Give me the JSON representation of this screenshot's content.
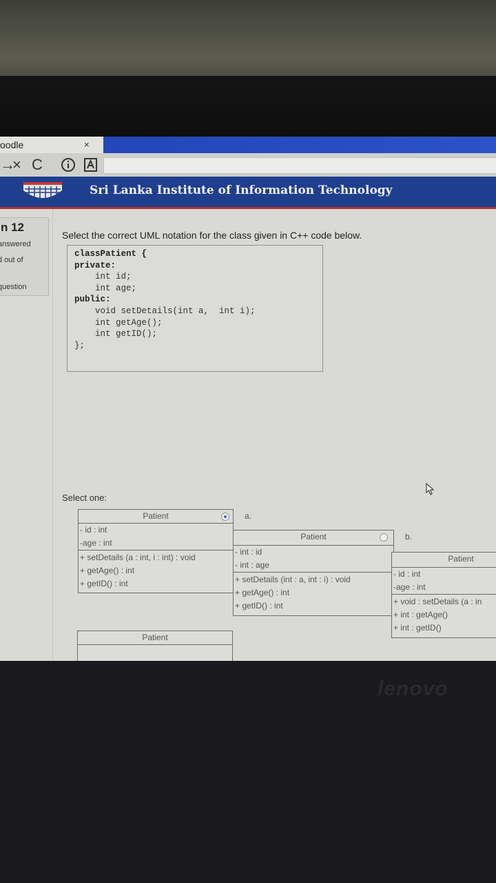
{
  "browser": {
    "tab_title": "oodle",
    "tab_close": "×",
    "nav_back": "→",
    "nav_close": "×",
    "nav_reload": "C"
  },
  "header": {
    "site_title": "Sri Lanka Institute of Information Technology"
  },
  "question_info": {
    "number": "n 12",
    "status": "answered",
    "marks": "d out of",
    "flag": "question"
  },
  "question": {
    "prompt": "Select the correct UML notation for the class given in C++ code below.",
    "code_lines": [
      {
        "indent": 0,
        "text": "classPatient {",
        "bold": true
      },
      {
        "indent": 0,
        "text": "private:",
        "bold": true
      },
      {
        "indent": 2,
        "text": "int id;",
        "bold": false
      },
      {
        "indent": 2,
        "text": "int age;",
        "bold": false
      },
      {
        "indent": 0,
        "text": "public:",
        "bold": true
      },
      {
        "indent": 2,
        "text": "void setDetails(int a,  int i);",
        "bold": false
      },
      {
        "indent": 2,
        "text": "int getAge();",
        "bold": false
      },
      {
        "indent": 2,
        "text": "int getID();",
        "bold": false
      },
      {
        "indent": 0,
        "text": "};",
        "bold": false
      }
    ],
    "select_one": "Select one:"
  },
  "options": [
    {
      "label": "a.",
      "selected": true,
      "class_name": "Patient",
      "attributes": [
        "- id : int",
        "-age : int"
      ],
      "methods": [
        "+ setDetails (a : int,  i : int) : void",
        "+ getAge() : int",
        "+ getID() : int"
      ]
    },
    {
      "label": "b.",
      "selected": false,
      "class_name": "Patient",
      "attributes": [
        "- int : id",
        "- int : age"
      ],
      "methods": [
        "+ setDetails (int : a,  int : i) : void",
        "+ getAge() : int",
        "+ getID() : int"
      ]
    },
    {
      "label": "",
      "selected": false,
      "class_name": "Patient",
      "attributes": [
        "- id : int",
        "-age : int"
      ],
      "methods": [
        "+ void : setDetails (a : in",
        "+ int : getAge()",
        "+ int : getID()"
      ]
    },
    {
      "label": "",
      "selected": false,
      "class_name": "Patient",
      "attributes": [],
      "methods": []
    }
  ],
  "monitor_brand": "lenovo",
  "colors": {
    "header_bg": "#1f3f8e",
    "header_accent": "#b23030",
    "tab_active": "#2346b8"
  }
}
